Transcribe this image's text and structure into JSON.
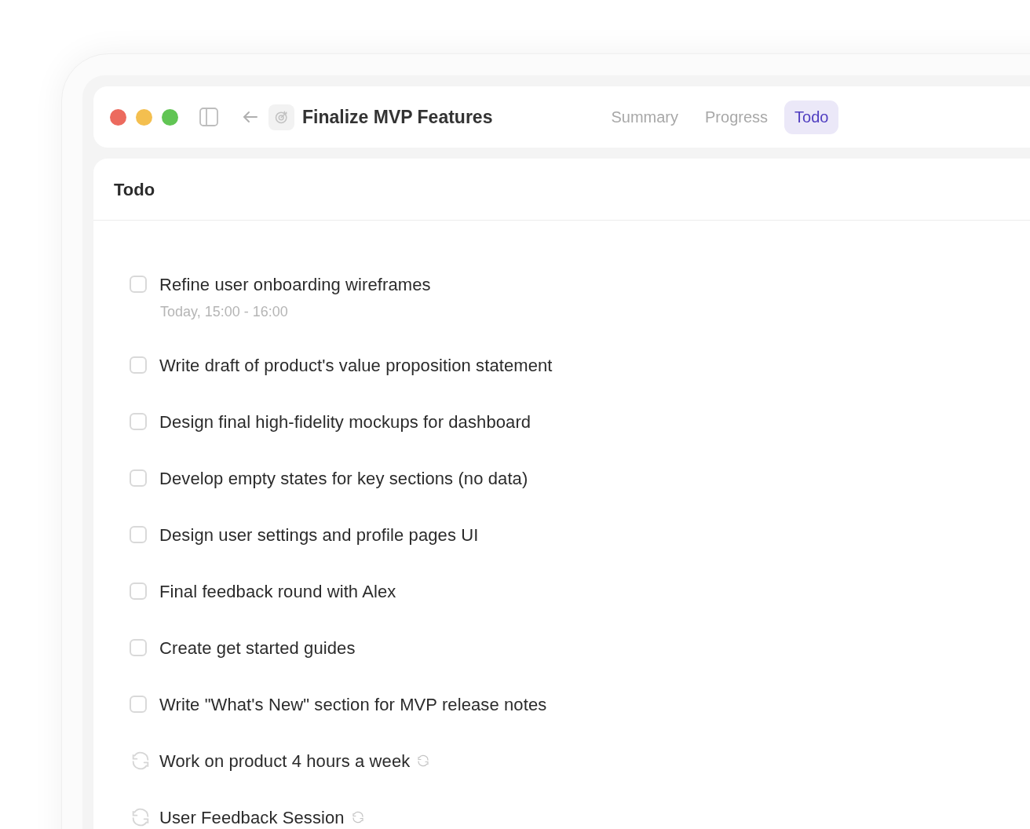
{
  "window": {
    "title": "Finalize MVP Features"
  },
  "tabs": [
    {
      "label": "Summary",
      "selected": false
    },
    {
      "label": "Progress",
      "selected": false
    },
    {
      "label": "Todo",
      "selected": true
    }
  ],
  "panel": {
    "title": "Todo"
  },
  "items": [
    {
      "kind": "task",
      "checked": false,
      "title": "Refine user onboarding wireframes",
      "subtitle": "Today, 15:00 - 16:00"
    },
    {
      "kind": "task",
      "checked": false,
      "title": "Write draft of product's value proposition statement"
    },
    {
      "kind": "task",
      "checked": false,
      "title": "Design final high-fidelity mockups for dashboard"
    },
    {
      "kind": "task",
      "checked": false,
      "title": "Develop empty states for key sections (no data)"
    },
    {
      "kind": "task",
      "checked": false,
      "title": "Design user settings and profile pages UI"
    },
    {
      "kind": "task",
      "checked": false,
      "title": "Final feedback round with Alex"
    },
    {
      "kind": "task",
      "checked": false,
      "title": "Create get started guides"
    },
    {
      "kind": "task",
      "checked": false,
      "title": "Write \"What's New\" section for MVP release notes"
    },
    {
      "kind": "recurring",
      "title": "Work on product 4 hours a week"
    },
    {
      "kind": "recurring",
      "title": "User Feedback Session"
    }
  ]
}
